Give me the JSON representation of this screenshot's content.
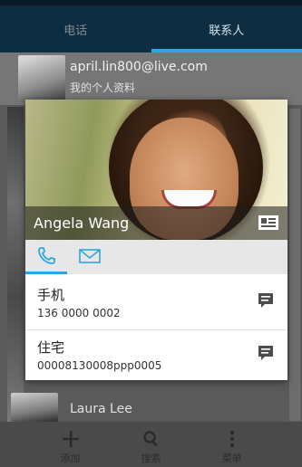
{
  "tabs": [
    {
      "label": "电话",
      "active": false
    },
    {
      "label": "联系人",
      "active": true
    }
  ],
  "self_row": {
    "email": "april.lin800@live.com",
    "subtitle": "我的个人资料"
  },
  "background_list": {
    "visible_contact": "Laura Lee"
  },
  "card": {
    "name": "Angela Wang",
    "entries": [
      {
        "label": "手机",
        "value": "136 0000 0002"
      },
      {
        "label": "住宅",
        "value": "00008130008ppp0005"
      }
    ],
    "accent_color": "#2aa8df"
  },
  "toolbar": {
    "add_label": "添加",
    "search_label": "搜索",
    "menu_label": "菜单"
  },
  "colors": {
    "header_bg": "#0f2d40",
    "accent": "#2aa8df"
  }
}
